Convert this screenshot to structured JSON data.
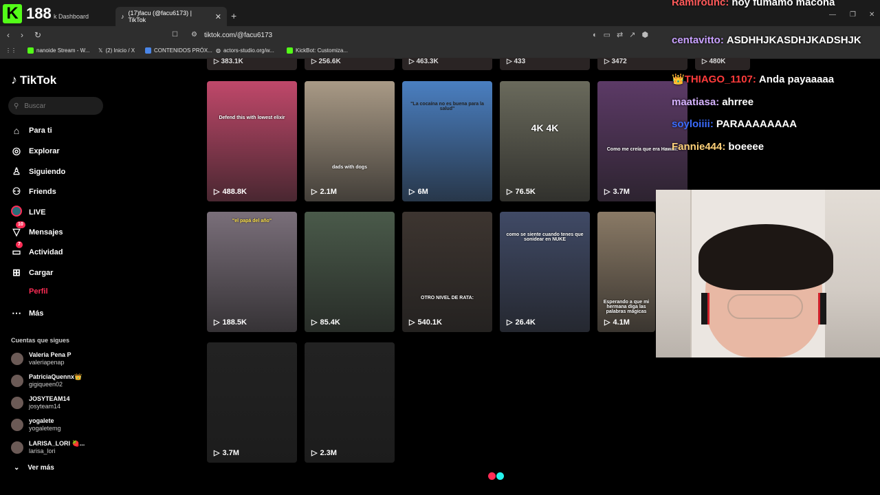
{
  "browser": {
    "tabs": [
      {
        "label": "k Dashboard"
      },
      {
        "label": "(17)facu (@facu6173) | TikTok"
      }
    ],
    "url": "tiktok.com/@facu6173",
    "bookmarks": [
      {
        "label": "nanoide Stream - W..."
      },
      {
        "label": "(2) Inicio / X"
      },
      {
        "label": "CONTENIDOS PRÓX..."
      },
      {
        "label": "actors-studio.org/w..."
      },
      {
        "label": "KickBot: Customiza..."
      }
    ]
  },
  "kick": {
    "viewer_count": "188"
  },
  "tiktok": {
    "brand": "TikTok",
    "search_placeholder": "Buscar",
    "nav": [
      {
        "label": "Para ti",
        "icon": "home-icon"
      },
      {
        "label": "Explorar",
        "icon": "compass-icon"
      },
      {
        "label": "Siguiendo",
        "icon": "following-icon"
      },
      {
        "label": "Friends",
        "icon": "friends-icon"
      },
      {
        "label": "LIVE",
        "icon": "live-icon"
      },
      {
        "label": "Mensajes",
        "icon": "messages-icon",
        "badge": "10"
      },
      {
        "label": "Actividad",
        "icon": "activity-icon",
        "badge": "7"
      },
      {
        "label": "Cargar",
        "icon": "upload-icon"
      },
      {
        "label": "Perfil",
        "icon": "profile-icon"
      },
      {
        "label": "Más",
        "icon": "more-icon"
      }
    ],
    "following_title": "Cuentas que sigues",
    "following": [
      {
        "name": "Valeria Pena P",
        "user": "valeriapenap"
      },
      {
        "name": "PatriciaQuennx👑",
        "user": "gigiqueen02"
      },
      {
        "name": "JOSYTEAM14",
        "user": "josyteam14"
      },
      {
        "name": "yogalete",
        "user": "yogaletemg"
      },
      {
        "name": "LARISA_LORI 🍓...",
        "user": "larisa_lori"
      }
    ],
    "see_more": "Ver más",
    "top_strip_views": [
      "383.1K",
      "256.6K",
      "463.3K",
      "433",
      "3472",
      "480K"
    ],
    "videos": [
      {
        "views": "488.8K",
        "caption": "Defend this with lowest elixir",
        "bg": "#c0486a"
      },
      {
        "views": "2.1M",
        "caption": "dads with dogs",
        "bg": "#a99a86"
      },
      {
        "views": "6M",
        "caption": "\"La cocaína no es buena para la salud\"",
        "bg": "#4a7fc1"
      },
      {
        "views": "76.5K",
        "caption": "4K 4K",
        "bg": "#6a6a5c"
      },
      {
        "views": "3.7M",
        "caption": "Como me creía que era Hawaii:",
        "bg": "#5c3a66"
      },
      {
        "views": "188.5K",
        "caption": "\"el papá del año\"",
        "bg": "#7a6f7a"
      },
      {
        "views": "85.4K",
        "caption": "",
        "bg": "#4a5a4a"
      },
      {
        "views": "540.1K",
        "caption": "OTRO NIVEL DE RATA:",
        "bg": "#3d3530"
      },
      {
        "views": "26.4K",
        "caption": "como se siente cuando tenes que sonidear en NUKE",
        "bg": "#404a66"
      },
      {
        "views": "4.1M",
        "caption": "Esperando a que mi hermana diga las palabras mágicas",
        "bg": "#8a7a66"
      },
      {
        "views": "3.7M",
        "caption": "",
        "bg": "#222"
      },
      {
        "views": "2.3M",
        "caption": "",
        "bg": "#222"
      }
    ]
  },
  "chat": [
    {
      "user": "Ramirounc:",
      "msg": "hoy fumamo macona",
      "color": "#ff5a5a"
    },
    {
      "user": "centavitto:",
      "msg": "ASDHHJKASDHJKADSHJK",
      "color": "#c8a0ff"
    },
    {
      "user": "👑THIAGO_1107:",
      "msg": "Anda payaaaaa",
      "color": "#ff3b3b"
    },
    {
      "user": "maatiasa:",
      "msg": "ahrree",
      "color": "#d6b3ff"
    },
    {
      "user": "soyloiiii:",
      "msg": "PARAAAAAAAA",
      "color": "#3b6cff"
    },
    {
      "user": "Fannie444:",
      "msg": "boeeee",
      "color": "#ffd27a"
    }
  ],
  "colors": {
    "accent": "#fe2c55",
    "kick": "#53fc18",
    "cyan": "#25f4ee"
  }
}
